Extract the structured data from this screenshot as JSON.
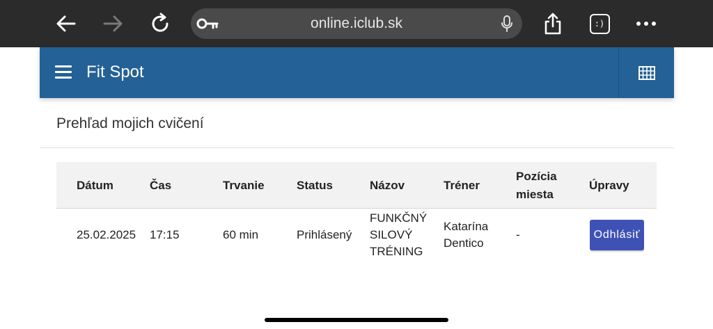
{
  "browser": {
    "url": "online.iclub.sk",
    "tabs_label": ":)"
  },
  "app": {
    "title": "Fit Spot"
  },
  "page": {
    "title": "Prehľad mojich cvičení"
  },
  "table": {
    "headers": {
      "datum": "Dátum",
      "cas": "Čas",
      "trvanie": "Trvanie",
      "status": "Status",
      "nazov": "Názov",
      "trener": "Tréner",
      "pozicia_line1": "Pozícia",
      "pozicia_line2": "miesta",
      "upravy": "Úpravy"
    },
    "rows": [
      {
        "datum": "25.02.2025",
        "cas": "17:15",
        "trvanie": "60 min",
        "status": "Prihlásený",
        "nazov_line1": "FUNKČNÝ",
        "nazov_line2": "SILOVÝ",
        "nazov_line3": "TRÉNING",
        "trener_line1": "Katarína",
        "trener_line2": "Dentico",
        "pozicia": "-",
        "action_label": "Odhlásiť"
      }
    ]
  }
}
